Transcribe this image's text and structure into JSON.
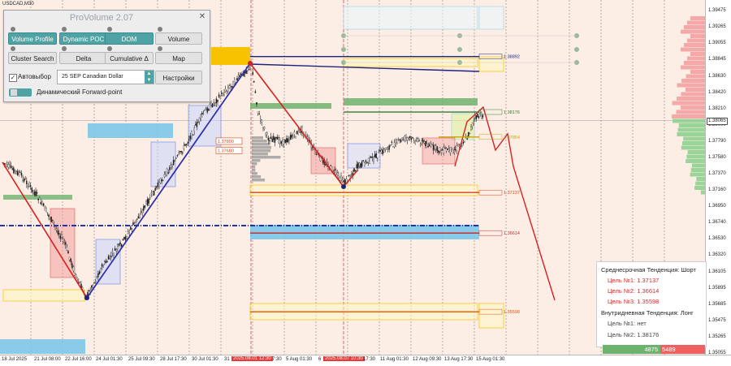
{
  "symbol": "USDCAD,M30",
  "panel": {
    "title": "ProVolume 2.07",
    "close_icon": "close-icon",
    "buttons_row1": [
      "Volume Profile",
      "Dynamic POC",
      "DOM",
      "Volume"
    ],
    "buttons_row2": [
      "Cluster Search",
      "Delta",
      "Cumulative Δ",
      "Map"
    ],
    "auto_select_label": "Автовыбор",
    "auto_select_checked": true,
    "instrument_value": "25 SEP Canadian Dollar",
    "settings_label": "Настройки",
    "forward_point_label": "Динамический Forward-point",
    "accent_color": "#4fa3a5"
  },
  "price_scale": {
    "labels": [
      "1.39475",
      "1.39265",
      "1.39055",
      "1.38845",
      "1.38630",
      "1.38420",
      "1.38210",
      "1.38000",
      "1.37790",
      "1.37580",
      "1.37370",
      "1.37160",
      "1.36950",
      "1.36740",
      "1.36530",
      "1.36320",
      "1.36105",
      "1.35895",
      "1.35685",
      "1.35475",
      "1.35265",
      "1.35055"
    ],
    "current_price": "1.38065"
  },
  "level_labels": [
    "1.38892",
    "1.38176",
    "1.37854",
    "1.37137",
    "1.36614",
    "1.35598"
  ],
  "box_labels": [
    "1.37800",
    "1.37680"
  ],
  "time_axis": {
    "labels": [
      "18 Jul 2025",
      "21 Jul 08:00",
      "22 Jul 16:00",
      "24 Jul 01:30",
      "25 Jul 09:30",
      "28 Jul 17:30",
      "30 Jul 01:30",
      "31",
      "2025.08.01 12:30",
      "7:30",
      "5 Aug 01:30",
      "6",
      "2025.08.07 10:30",
      "17:30",
      "11 Aug 01:30",
      "12 Aug 09:30",
      "13 Aug 17:30",
      "15 Aug 01:30"
    ],
    "highlighted": [
      "2025.08.01 12:30",
      "2025.08.07 10:30"
    ]
  },
  "info_panel": {
    "medium_trend": "Среднесрочная Тенденция: Шорт",
    "medium_targets": [
      "Цель №1: 1.37137",
      "Цель №2: 1.36614",
      "Цель №3: 1.35598"
    ],
    "intraday_trend_prefix": "Внутридневная Тенденция: ",
    "intraday_trend_value": "Лонг",
    "intraday_targets": [
      "Цель №1: нет",
      "Цель №2: 1.38176"
    ]
  },
  "volume_balance": {
    "buy": "4875",
    "sell": "5489",
    "buy_color": "#6db36d",
    "sell_color": "#f06060"
  },
  "colors": {
    "background": "#fdeee5",
    "bull_candle": "#1f1f1f",
    "trend_line": "#d62020",
    "up_line": "#2233bb",
    "buy_zone": "#7cc6e8",
    "sell_zone": "#f7c300",
    "green_zone": "#6fb36f",
    "red_zone": "#f3a0a0"
  }
}
